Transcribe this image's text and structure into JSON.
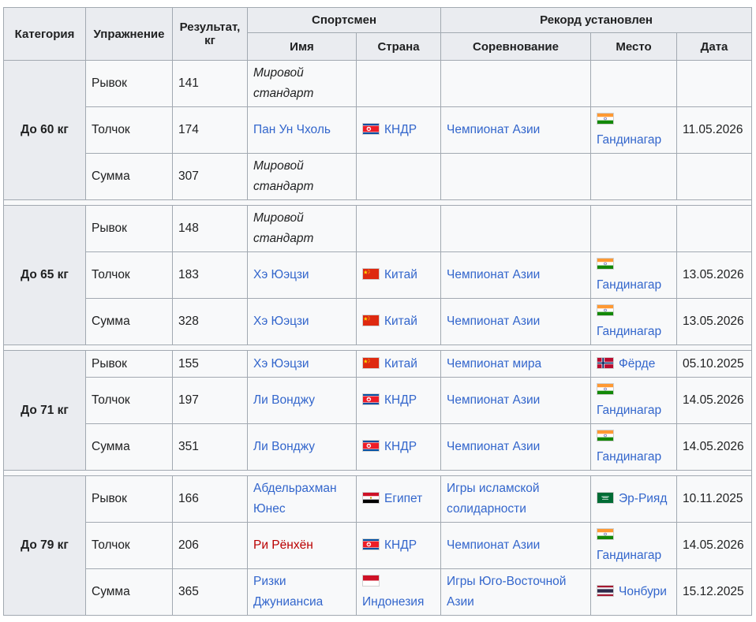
{
  "headers": {
    "category": "Категория",
    "exercise": "Упражнение",
    "result": "Результат, кг",
    "athlete": "Спортсмен",
    "record_set": "Рекорд установлен",
    "name": "Имя",
    "country": "Страна",
    "competition": "Соревнование",
    "place": "Место",
    "date": "Дата"
  },
  "groups": [
    {
      "category": "До 60 кг",
      "rows": [
        {
          "exercise": "Рывок",
          "result": "141",
          "name": "Мировой стандарт",
          "name_style": "italic",
          "country": "",
          "flag": "",
          "competition": "",
          "place": "",
          "place_flag": "",
          "date": ""
        },
        {
          "exercise": "Толчок",
          "result": "174",
          "name": "Пан Ун Чхоль",
          "name_style": "link",
          "country": "КНДР",
          "flag": "north-korea",
          "competition": "Чемпионат Азии",
          "place": "Гандинагар",
          "place_flag": "india",
          "date": "11.05.2026"
        },
        {
          "exercise": "Сумма",
          "result": "307",
          "name": "Мировой стандарт",
          "name_style": "italic",
          "country": "",
          "flag": "",
          "competition": "",
          "place": "",
          "place_flag": "",
          "date": ""
        }
      ]
    },
    {
      "category": "До 65 кг",
      "rows": [
        {
          "exercise": "Рывок",
          "result": "148",
          "name": "Мировой стандарт",
          "name_style": "italic",
          "country": "",
          "flag": "",
          "competition": "",
          "place": "",
          "place_flag": "",
          "date": ""
        },
        {
          "exercise": "Толчок",
          "result": "183",
          "name": "Хэ Юэцзи",
          "name_style": "link",
          "country": "Китай",
          "flag": "china",
          "competition": "Чемпионат Азии",
          "place": "Гандинагар",
          "place_flag": "india",
          "date": "13.05.2026"
        },
        {
          "exercise": "Сумма",
          "result": "328",
          "name": "Хэ Юэцзи",
          "name_style": "link",
          "country": "Китай",
          "flag": "china",
          "competition": "Чемпионат Азии",
          "place": "Гандинагар",
          "place_flag": "india",
          "date": "13.05.2026"
        }
      ]
    },
    {
      "category": "До 71 кг",
      "rows": [
        {
          "exercise": "Рывок",
          "result": "155",
          "name": "Хэ Юэцзи",
          "name_style": "link",
          "country": "Китай",
          "flag": "china",
          "competition": "Чемпионат мира",
          "place": "Фёрде",
          "place_flag": "norway",
          "date": "05.10.2025"
        },
        {
          "exercise": "Толчок",
          "result": "197",
          "name": "Ли Вонджу",
          "name_style": "link",
          "country": "КНДР",
          "flag": "north-korea",
          "competition": "Чемпионат Азии",
          "place": "Гандинагар",
          "place_flag": "india",
          "date": "14.05.2026"
        },
        {
          "exercise": "Сумма",
          "result": "351",
          "name": "Ли Вонджу",
          "name_style": "link",
          "country": "КНДР",
          "flag": "north-korea",
          "competition": "Чемпионат Азии",
          "place": "Гандинагар",
          "place_flag": "india",
          "date": "14.05.2026"
        }
      ]
    },
    {
      "category": "До 79 кг",
      "rows": [
        {
          "exercise": "Рывок",
          "result": "166",
          "name": "Абдельрахман Юнес",
          "name_style": "link",
          "country": "Египет",
          "flag": "egypt",
          "competition": "Игры исламской солидарности",
          "place": "Эр-Рияд",
          "place_flag": "saudi-arabia",
          "date": "10.11.2025"
        },
        {
          "exercise": "Толчок",
          "result": "206",
          "name": "Ри Рёнхён",
          "name_style": "redlink",
          "country": "КНДР",
          "flag": "north-korea",
          "competition": "Чемпионат Азии",
          "place": "Гандинагар",
          "place_flag": "india",
          "date": "14.05.2026"
        },
        {
          "exercise": "Сумма",
          "result": "365",
          "name": "Ризки Джуниансиа",
          "name_style": "link",
          "country": "Индонезия",
          "flag": "indonesia",
          "competition": "Игры Юго-Восточной Азии",
          "place": "Чонбури",
          "place_flag": "thailand",
          "date": "15.12.2025"
        }
      ]
    }
  ]
}
